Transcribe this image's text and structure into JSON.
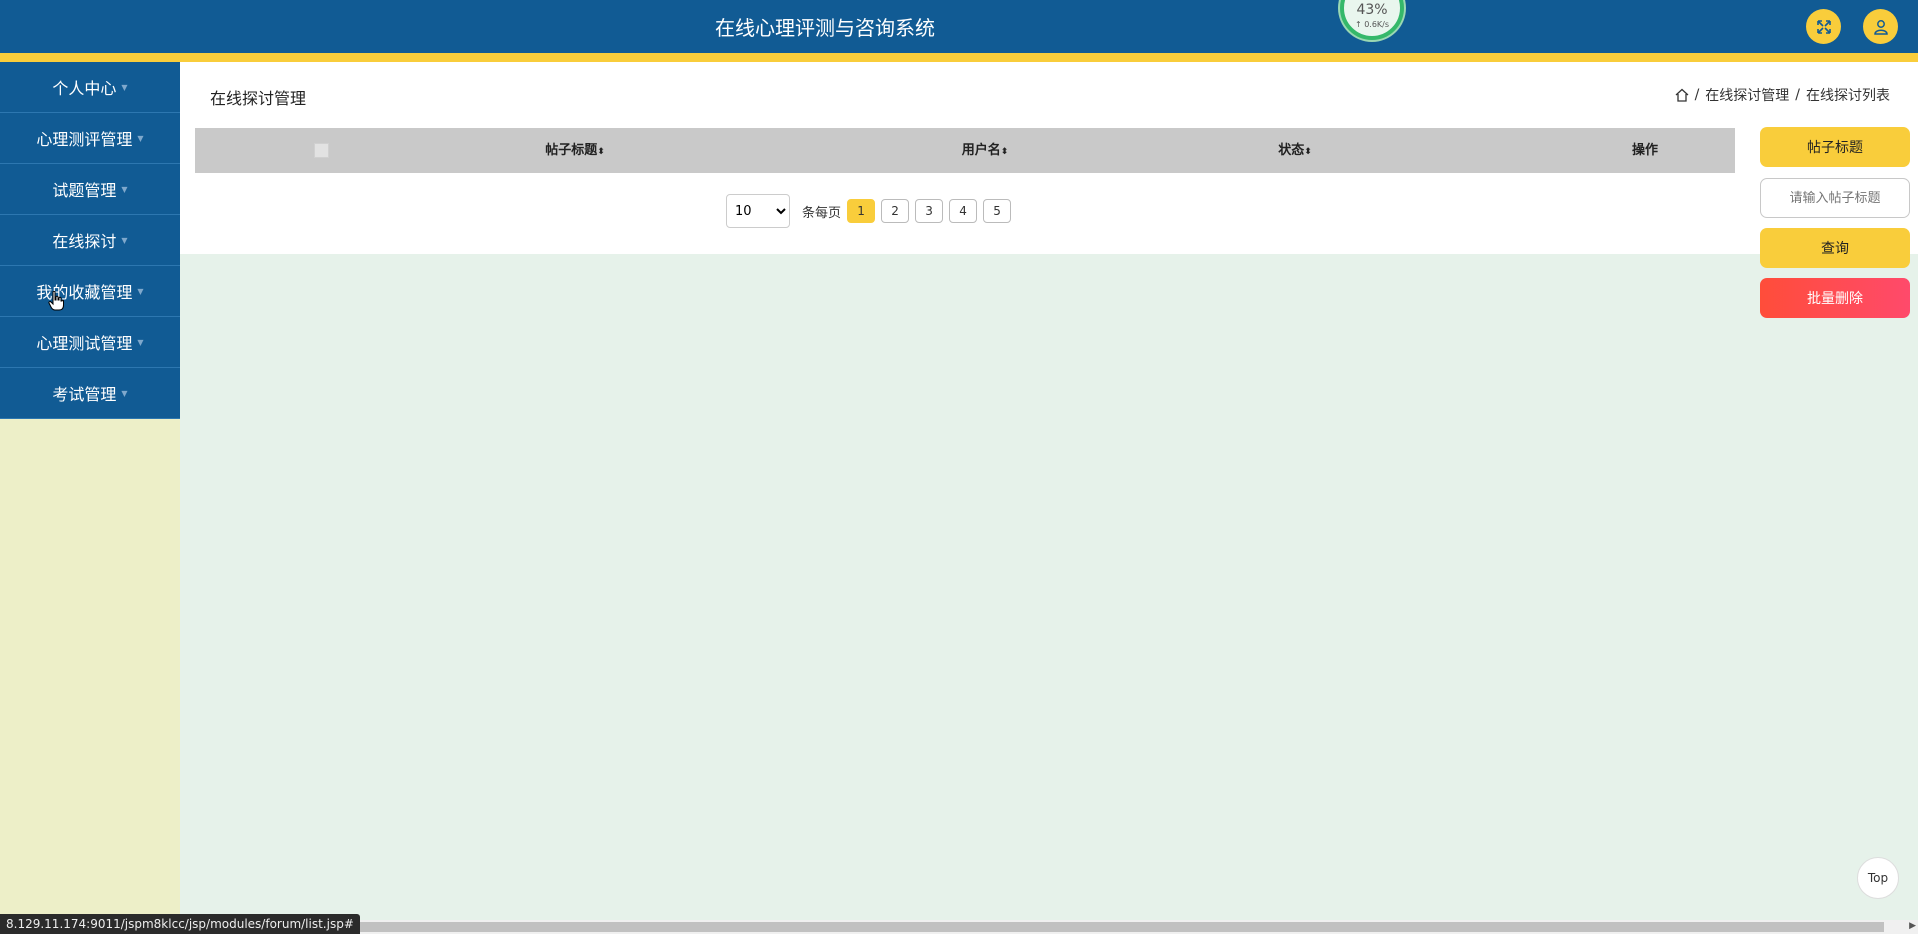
{
  "header": {
    "title": "在线心理评测与咨询系统",
    "net_percent": "43%",
    "net_speed": "↑ 0.6K/s",
    "fullscreen_icon": "expand-icon",
    "user_icon": "user-icon"
  },
  "sidebar": {
    "items": [
      {
        "label": "个人中心"
      },
      {
        "label": "心理测评管理"
      },
      {
        "label": "试题管理"
      },
      {
        "label": "在线探讨"
      },
      {
        "label": "我的收藏管理"
      },
      {
        "label": "心理测试管理"
      },
      {
        "label": "考试管理"
      }
    ]
  },
  "page": {
    "title": "在线探讨管理",
    "breadcrumb": [
      "在线探讨管理",
      "在线探讨列表"
    ]
  },
  "table": {
    "columns": [
      "帖子标题",
      "用户名",
      "状态",
      "操作"
    ]
  },
  "pager": {
    "page_size": "10",
    "page_size_options": [
      "10"
    ],
    "per_page_label": "条每页",
    "pages": [
      "1",
      "2",
      "3",
      "4",
      "5"
    ],
    "current": "1"
  },
  "search": {
    "field_label": "帖子标题",
    "placeholder": "请输入帖子标题",
    "query_label": "查询",
    "batch_delete_label": "批量删除"
  },
  "top_label": "Top",
  "status_url": "8.129.11.174:9011/jspm8klcc/jsp/modules/forum/list.jsp#",
  "colors": {
    "primary": "#115b94",
    "accent": "#f9cd3b",
    "danger": "#ff4f4f",
    "sidebar_bg": "#edefc8",
    "content_bg": "#e6f2ea"
  }
}
